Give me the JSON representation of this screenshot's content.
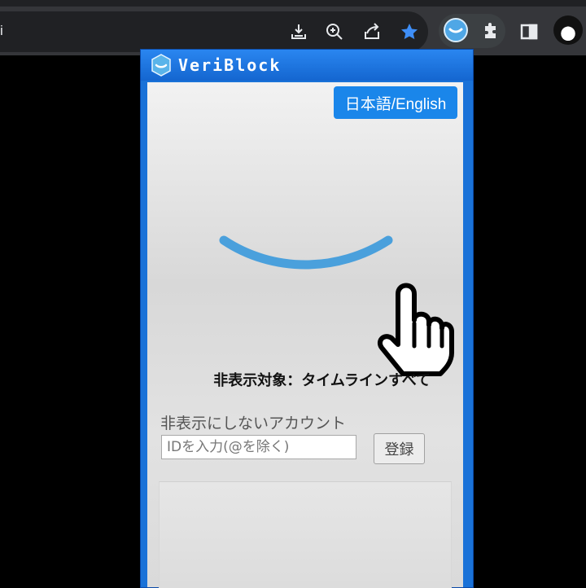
{
  "browser": {
    "address_text": "i",
    "icons": [
      "download-icon",
      "zoom-icon",
      "share-icon",
      "bookmark-star-icon",
      "veriblock-extension-icon",
      "extensions-puzzle-icon",
      "side-panel-icon",
      "profile-avatar"
    ],
    "colors": {
      "star": "#3e8ef7",
      "toolbar": "#35363a",
      "omnibox": "#202124"
    }
  },
  "popup": {
    "title": "VeriBlock",
    "language_button": "日本語/English",
    "hidden_target_text": "非表示対象：タイムラインすべて",
    "exclude_label": "非表示にしないアカウント",
    "id_input": {
      "placeholder": "IDを入力(@を除く)",
      "value": ""
    },
    "register_button": "登録",
    "colors": {
      "accent": "#1a86ea",
      "frame": "#1a72d8",
      "smile": "#4aa0dc"
    }
  }
}
